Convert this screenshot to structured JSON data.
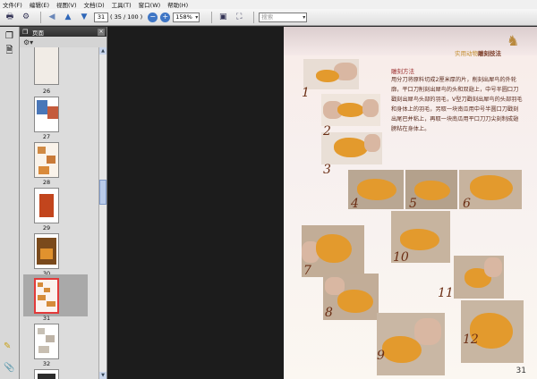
{
  "menu": [
    "文件(F)",
    "编辑(E)",
    "视图(V)",
    "文档(D)",
    "工具(T)",
    "窗口(W)",
    "帮助(H)"
  ],
  "toolbar": {
    "current_page": "31",
    "page_count": "( 35 / 100 )",
    "zoom": "158%",
    "search_placeholder": "搜索"
  },
  "panel": {
    "title": "页面",
    "thumbnails": [
      {
        "label": "26",
        "selected": false
      },
      {
        "label": "27",
        "selected": false
      },
      {
        "label": "28",
        "selected": false
      },
      {
        "label": "29",
        "selected": false
      },
      {
        "label": "30",
        "selected": false
      },
      {
        "label": "31",
        "selected": true
      },
      {
        "label": "32",
        "selected": false
      }
    ]
  },
  "page": {
    "header_prefix": "实用动物",
    "header_bold": "雕刻技法",
    "method_title": "雕刻方法",
    "method_text": "用分刀将原料切成2厘米厚的片，削刻出犀鸟的外轮廓，平口刀削刻出犀鸟的头和双翅上，中号半圆口刀戳刻出犀鸟头部的羽毛，V型刀戳刻出犀鸟的头部羽毛和身体上的羽毛，另取一块南瓜用中号半圆口刀戳刻出尾巴并粘上，再取一块南瓜用平口刀刀尖刻制成翅膀粘在身体上。",
    "step_numbers": [
      "1",
      "2",
      "3",
      "4",
      "5",
      "6",
      "7",
      "8",
      "9",
      "10",
      "11",
      "12"
    ],
    "page_number": "31"
  },
  "colors": {
    "accent_red": "#9b2c2c",
    "step_brown": "#6b2e14",
    "pumpkin": "#e39a2d"
  }
}
